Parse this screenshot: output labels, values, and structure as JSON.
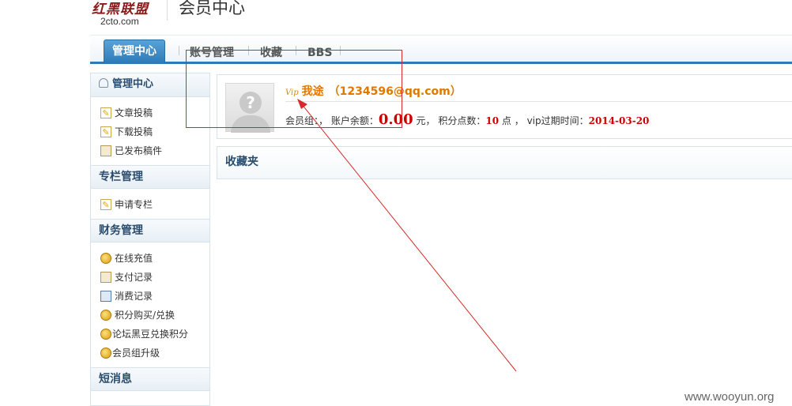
{
  "header": {
    "logo_cn": "红黑联盟",
    "logo_en": "2cto.com",
    "title": "会员中心"
  },
  "tabs": [
    {
      "label": "管理中心",
      "active": true
    },
    {
      "label": "账号管理",
      "active": false
    },
    {
      "label": "收藏",
      "active": false
    },
    {
      "label": "BBS",
      "active": false
    }
  ],
  "sidebar": {
    "sections": [
      {
        "title": "管理中心",
        "items": [
          {
            "label": "文章投稿",
            "icon": "edit-icon"
          },
          {
            "label": "下载投稿",
            "icon": "edit-icon"
          },
          {
            "label": "已发布稿件",
            "icon": "document-icon"
          }
        ]
      },
      {
        "title": "专栏管理",
        "items": [
          {
            "label": "申请专栏",
            "icon": "edit-icon"
          }
        ]
      },
      {
        "title": "财务管理",
        "items": [
          {
            "label": "在线充值",
            "icon": "coins-icon"
          },
          {
            "label": "支付记录",
            "icon": "document-icon"
          },
          {
            "label": "消费记录",
            "icon": "calculator-icon"
          },
          {
            "label": "积分购买/兑换",
            "icon": "coins-icon"
          },
          {
            "label": "论坛黑豆兑换积分",
            "icon": "coins-icon"
          },
          {
            "label": "会员组升级",
            "icon": "coins-icon"
          }
        ]
      },
      {
        "title": "短消息",
        "items": []
      }
    ]
  },
  "profile": {
    "vip_badge": "Vip",
    "username": "我途",
    "email": "（1234596@qq.com）",
    "group_label": "会员组：，",
    "balance_label": "账户余额：",
    "balance_value": "0.00",
    "balance_unit": "元，",
    "points_label": "积分点数：",
    "points_value": "10",
    "points_unit": "点 ，",
    "vip_expire_label": "vip过期时间：",
    "vip_expire_value": "2014-03-20"
  },
  "favorites": {
    "title": "收藏夹"
  },
  "watermark": "www.wooyun.org",
  "colors": {
    "accent_blue": "#2d7ab9",
    "annotation_red": "#d62a2a",
    "balance_red": "#cc0000",
    "username_orange": "#e07800"
  }
}
